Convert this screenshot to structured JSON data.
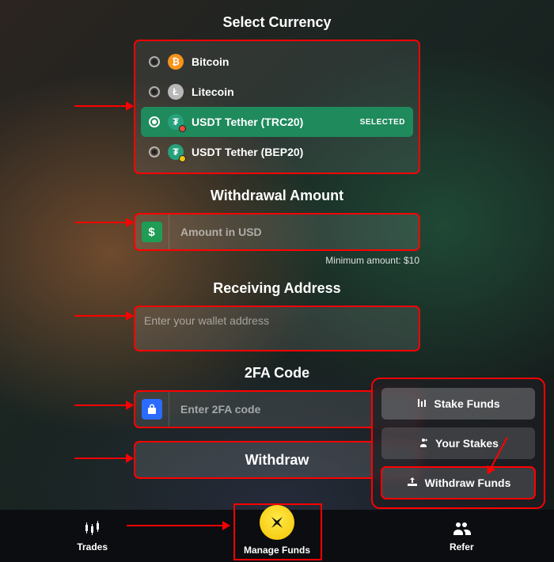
{
  "headings": {
    "currency": "Select Currency",
    "amount": "Withdrawal Amount",
    "address": "Receiving Address",
    "twofa": "2FA Code"
  },
  "currencies": [
    {
      "label": "Bitcoin",
      "icon": "btc",
      "glyph": "₿",
      "selected": false
    },
    {
      "label": "Litecoin",
      "icon": "ltc",
      "glyph": "Ł",
      "selected": false
    },
    {
      "label": "USDT Tether (TRC20)",
      "icon": "usdt",
      "glyph": "₮",
      "sub": "red",
      "selected": true,
      "badge": "SELECTED"
    },
    {
      "label": "USDT Tether (BEP20)",
      "icon": "usdt",
      "glyph": "₮",
      "sub": "yel",
      "selected": false
    }
  ],
  "amount": {
    "placeholder": "Amount in USD",
    "min_label": "Minimum amount: $10"
  },
  "address": {
    "placeholder": "Enter your wallet address"
  },
  "twofa": {
    "placeholder": "Enter 2FA code"
  },
  "withdraw_label": "Withdraw",
  "popup": {
    "stake": "Stake Funds",
    "your_stakes": "Your Stakes",
    "withdraw_funds": "Withdraw Funds"
  },
  "nav": {
    "trades": "Trades",
    "manage": "Manage Funds",
    "refer": "Refer"
  }
}
